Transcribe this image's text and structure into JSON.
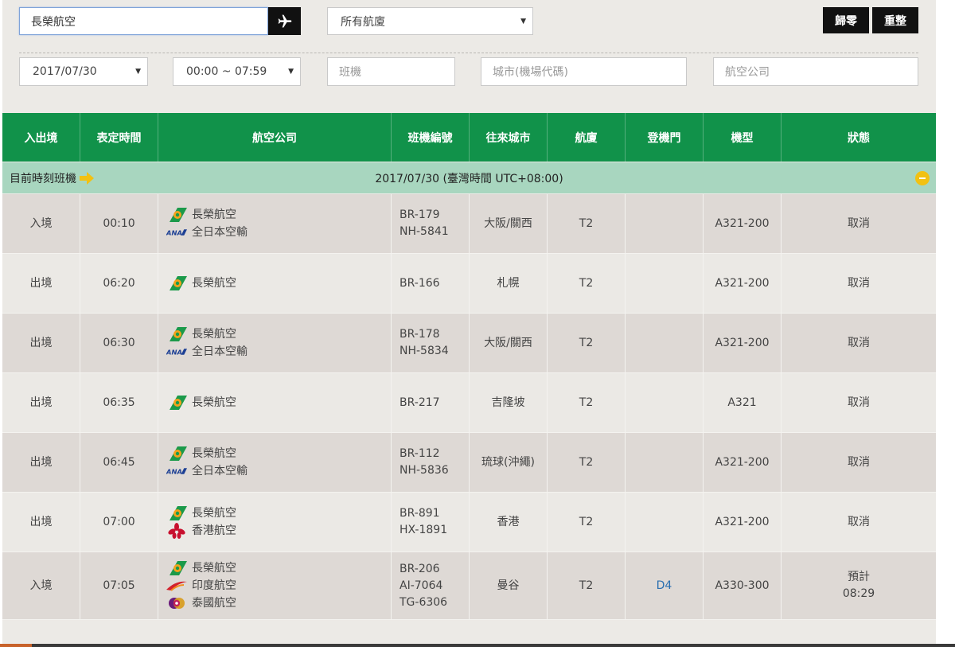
{
  "search": {
    "value": "長榮航空",
    "go_icon": "plane-icon"
  },
  "terminal_select": {
    "value": "所有航廈"
  },
  "buttons": {
    "reset_zero": "歸零",
    "reset": "重整"
  },
  "filters": {
    "date": "2017/07/30",
    "time_range": "00:00 ~ 07:59",
    "flight_placeholder": "班機",
    "city_placeholder": "城市(機場代碼)",
    "airline_placeholder": "航空公司"
  },
  "table": {
    "headers": [
      "入出境",
      "表定時間",
      "航空公司",
      "班機編號",
      "往來城市",
      "航廈",
      "登機門",
      "機型",
      "狀態"
    ],
    "subheader": {
      "left": "目前時刻班機",
      "center": "2017/07/30 (臺灣時間 UTC+08:00)"
    },
    "rows": [
      {
        "direction": "入境",
        "time": "00:10",
        "airlines": [
          {
            "name": "長榮航空",
            "logo": "eva-air-logo"
          },
          {
            "name": "全日本空輸",
            "logo": "ana-logo"
          }
        ],
        "flights": [
          "BR-179",
          "NH-5841"
        ],
        "city": "大阪/關西",
        "terminal": "T2",
        "gate": "",
        "aircraft": "A321-200",
        "status": "取消"
      },
      {
        "direction": "出境",
        "time": "06:20",
        "airlines": [
          {
            "name": "長榮航空",
            "logo": "eva-air-logo"
          }
        ],
        "flights": [
          "BR-166"
        ],
        "city": "札幌",
        "terminal": "T2",
        "gate": "",
        "aircraft": "A321-200",
        "status": "取消"
      },
      {
        "direction": "出境",
        "time": "06:30",
        "airlines": [
          {
            "name": "長榮航空",
            "logo": "eva-air-logo"
          },
          {
            "name": "全日本空輸",
            "logo": "ana-logo"
          }
        ],
        "flights": [
          "BR-178",
          "NH-5834"
        ],
        "city": "大阪/關西",
        "terminal": "T2",
        "gate": "",
        "aircraft": "A321-200",
        "status": "取消"
      },
      {
        "direction": "出境",
        "time": "06:35",
        "airlines": [
          {
            "name": "長榮航空",
            "logo": "eva-air-logo"
          }
        ],
        "flights": [
          "BR-217"
        ],
        "city": "吉隆坡",
        "terminal": "T2",
        "gate": "",
        "aircraft": "A321",
        "status": "取消"
      },
      {
        "direction": "出境",
        "time": "06:45",
        "airlines": [
          {
            "name": "長榮航空",
            "logo": "eva-air-logo"
          },
          {
            "name": "全日本空輸",
            "logo": "ana-logo"
          }
        ],
        "flights": [
          "BR-112",
          "NH-5836"
        ],
        "city": "琉球(沖繩)",
        "terminal": "T2",
        "gate": "",
        "aircraft": "A321-200",
        "status": "取消"
      },
      {
        "direction": "出境",
        "time": "07:00",
        "airlines": [
          {
            "name": "長榮航空",
            "logo": "eva-air-logo"
          },
          {
            "name": "香港航空",
            "logo": "hong-kong-airlines-logo"
          }
        ],
        "flights": [
          "BR-891",
          "HX-1891"
        ],
        "city": "香港",
        "terminal": "T2",
        "gate": "",
        "aircraft": "A321-200",
        "status": "取消"
      },
      {
        "direction": "入境",
        "time": "07:05",
        "airlines": [
          {
            "name": "長榮航空",
            "logo": "eva-air-logo"
          },
          {
            "name": "印度航空",
            "logo": "air-india-logo"
          },
          {
            "name": "泰國航空",
            "logo": "thai-airways-logo"
          }
        ],
        "flights": [
          "BR-206",
          "AI-7064",
          "TG-6306"
        ],
        "city": "曼谷",
        "terminal": "T2",
        "gate": "D4",
        "aircraft": "A330-300",
        "status": "預計\n08:29"
      }
    ]
  },
  "colors": {
    "header_green": "#11924a",
    "subheader_green": "#a8d6bf",
    "row_dark": "#ded9d5",
    "row_light": "#ebe9e5",
    "gate_blue": "#2a6fb0"
  }
}
